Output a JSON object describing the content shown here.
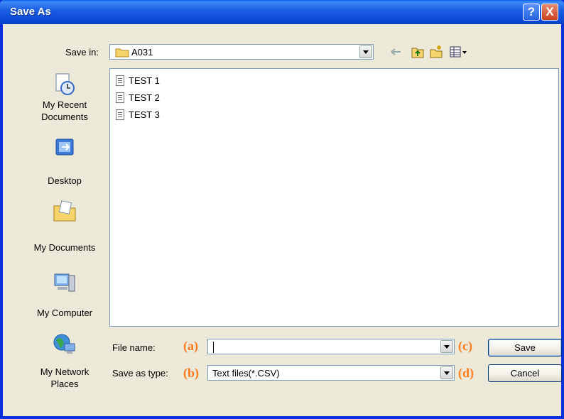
{
  "window": {
    "title": "Save As"
  },
  "titlebar": {
    "help_glyph": "?",
    "close_glyph": "X"
  },
  "save_in": {
    "label": "Save in:",
    "value": "A031"
  },
  "toolbar": {
    "icons": [
      "back-arrow-icon",
      "up-one-level-icon",
      "create-new-folder-icon",
      "view-menu-icon"
    ]
  },
  "places": [
    {
      "label": "My Recent Documents",
      "icon": "recent-documents-icon"
    },
    {
      "label": "Desktop",
      "icon": "desktop-icon"
    },
    {
      "label": "My Documents",
      "icon": "my-documents-icon"
    },
    {
      "label": "My Computer",
      "icon": "my-computer-icon"
    },
    {
      "label": "My Network Places",
      "icon": "network-places-icon"
    }
  ],
  "files": [
    "TEST 1",
    "TEST 2",
    "TEST 3"
  ],
  "file_name": {
    "label": "File name:",
    "value": ""
  },
  "save_as_type": {
    "label": "Save as type:",
    "value": "Text files(*.CSV)"
  },
  "buttons": {
    "save": "Save",
    "cancel": "Cancel"
  },
  "annotations": {
    "a": "(a)",
    "b": "(b)",
    "c": "(c)",
    "d": "(d)"
  },
  "colors": {
    "annotation": "#ff7a1a",
    "titlebar": "#0a48d6"
  }
}
